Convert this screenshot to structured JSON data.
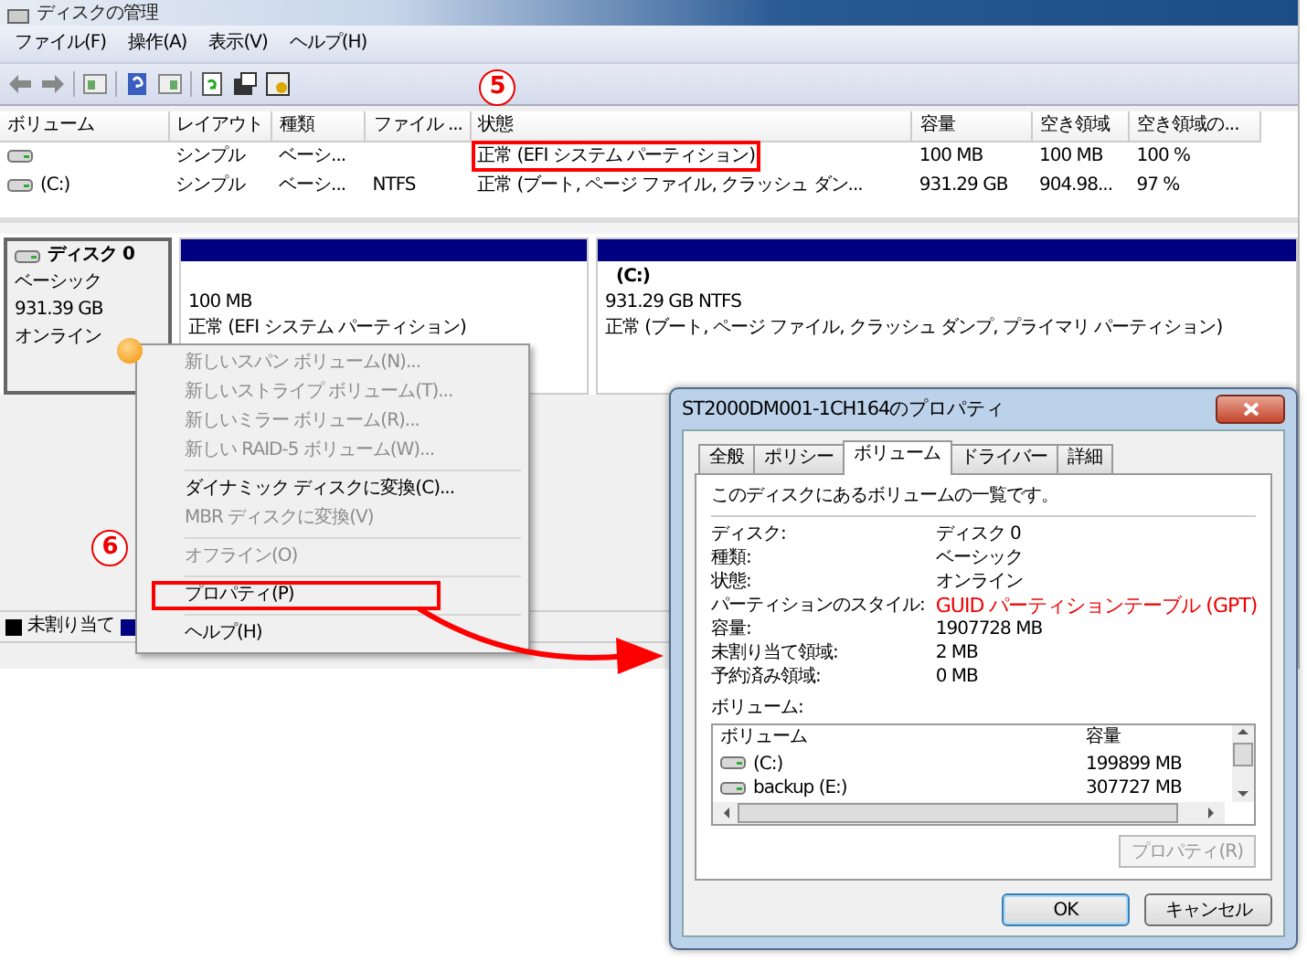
{
  "window": {
    "title": "ディスクの管理"
  },
  "menu_bar": [
    "ファイル(F)",
    "操作(A)",
    "表示(V)",
    "ヘルプ(H)"
  ],
  "volume_table": {
    "columns": [
      "ボリューム",
      "レイアウト",
      "種類",
      "ファイル ...",
      "状態",
      "容量",
      "空き領域",
      "空き領域の..."
    ],
    "rows": [
      {
        "layout": "シンプル",
        "type": "ベーシ...",
        "status": "正常 (EFI システム パーティション)",
        "capacity": "100 MB",
        "free": "100 MB",
        "free_percent": "100 %"
      },
      {
        "volume": "(C:)",
        "layout": "シンプル",
        "type": "ベーシ...",
        "file_system": "NTFS",
        "status": "正常 (ブート, ページ ファイル, クラッシュ ダン...",
        "capacity": "931.29 GB",
        "free": "904.98...",
        "free_percent": "97 %"
      }
    ]
  },
  "disk": {
    "name": "ディスク 0",
    "type": "ベーシック",
    "size": "931.39 GB",
    "status": "オンライン"
  },
  "partitions": [
    {
      "size": "100 MB",
      "status": "正常 (EFI システム パーティション)"
    },
    {
      "name": "(C:)",
      "size": "931.29 GB NTFS",
      "status": "正常 (ブート, ページ ファイル, クラッシュ ダンプ, プライマリ パーティション)"
    }
  ],
  "legend": [
    {
      "label": "未割り当て",
      "color": "#000000"
    },
    {
      "color": "#000080"
    }
  ],
  "context_menu": {
    "groups": [
      [
        {
          "label": "新しいスパン ボリューム(N)...",
          "disabled": true
        },
        {
          "label": "新しいストライプ ボリューム(T)...",
          "disabled": true
        },
        {
          "label": "新しいミラー ボリューム(R)...",
          "disabled": true
        },
        {
          "label": "新しい RAID-5 ボリューム(W)...",
          "disabled": true
        }
      ],
      [
        {
          "label": "ダイナミック ディスクに変換(C)...",
          "disabled": false
        },
        {
          "label": "MBR ディスクに変換(V)",
          "disabled": true
        }
      ],
      [
        {
          "label": "オフライン(O)",
          "disabled": true
        }
      ],
      [
        {
          "label": "プロパティ(P)",
          "disabled": false
        }
      ],
      [
        {
          "label": "ヘルプ(H)",
          "disabled": false
        }
      ]
    ]
  },
  "annotations": [
    {
      "label": "5"
    },
    {
      "label": "6"
    }
  ],
  "dialog": {
    "title": "ST2000DM001-1CH164のプロパティ",
    "tabs": [
      {
        "label": "全般",
        "selected": false
      },
      {
        "label": "ポリシー",
        "selected": false
      },
      {
        "label": "ボリューム",
        "selected": true
      },
      {
        "label": "ドライバー",
        "selected": false
      },
      {
        "label": "詳細",
        "selected": false
      }
    ],
    "description": "このディスクにあるボリュームの一覧です。",
    "fields": [
      {
        "label": "ディスク:",
        "value": "ディスク 0",
        "highlighted": false
      },
      {
        "label": "種類:",
        "value": "ベーシック",
        "highlighted": false
      },
      {
        "label": "状態:",
        "value": "オンライン",
        "highlighted": false
      },
      {
        "label": "パーティションのスタイル:",
        "value": "GUID パーティションテーブル (GPT)",
        "highlighted": true
      },
      {
        "label": "容量:",
        "value": "1907728 MB",
        "highlighted": false
      },
      {
        "label": "未割り当て領域:",
        "value": "2 MB",
        "highlighted": false
      },
      {
        "label": "予約済み領域:",
        "value": "0 MB",
        "highlighted": false
      }
    ],
    "volumes_label": "ボリューム:",
    "volume_list": {
      "columns": [
        "ボリューム",
        "容量"
      ],
      "rows": [
        {
          "name": "(C:)",
          "capacity": "199899 MB"
        },
        {
          "name": "backup (E:)",
          "capacity": "307727 MB"
        }
      ]
    },
    "properties_button": {
      "label": "プロパティ(R)",
      "disabled": true
    },
    "buttons": [
      {
        "label": "OK",
        "default": true
      },
      {
        "label": "キャンセル",
        "default": false
      }
    ]
  }
}
